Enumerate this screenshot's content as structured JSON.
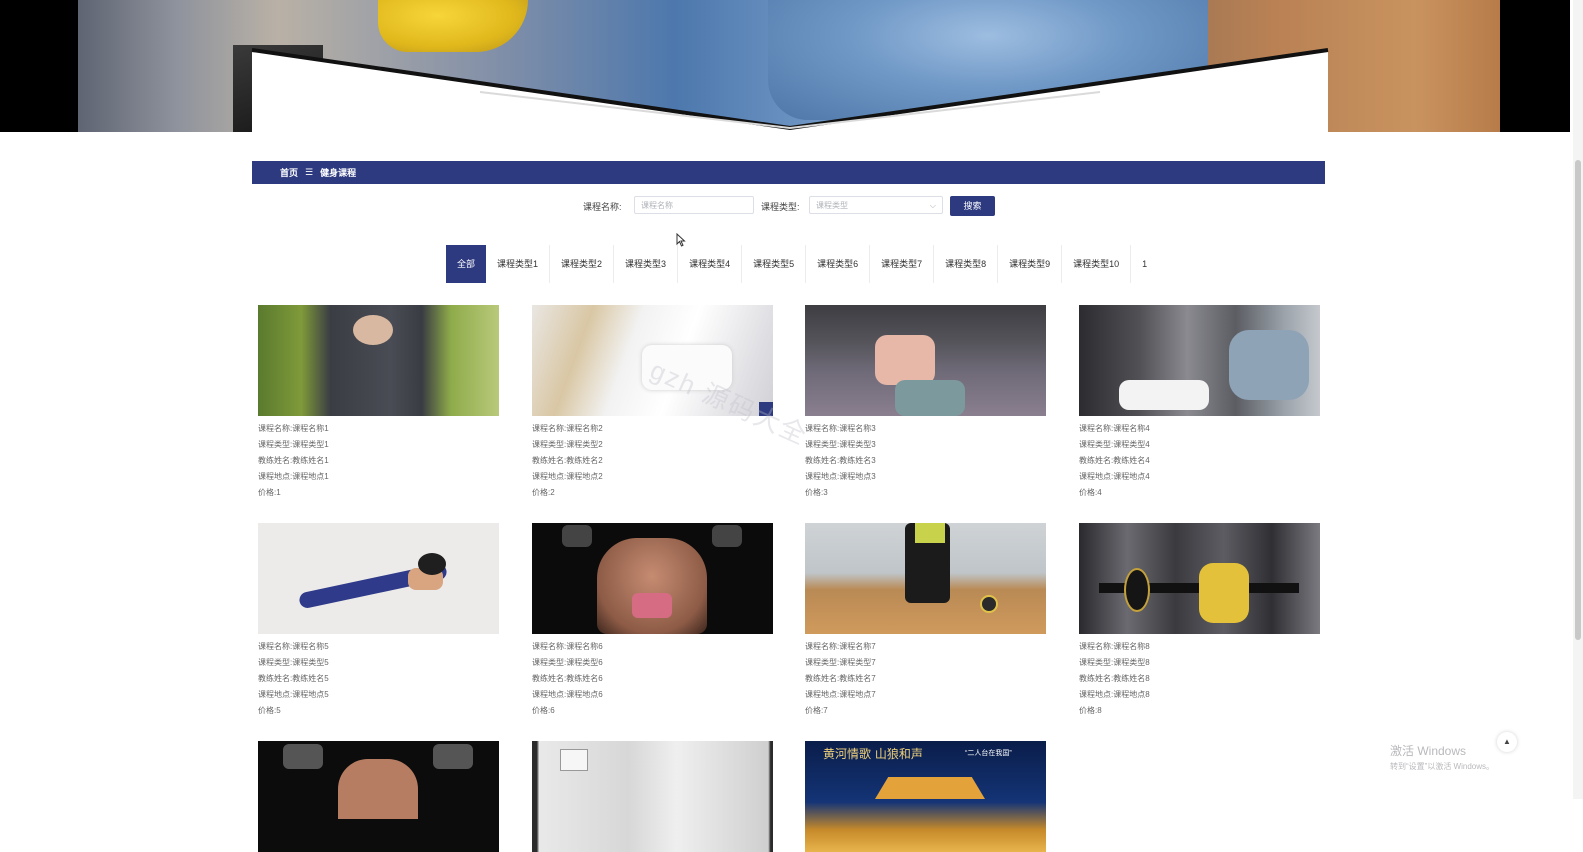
{
  "breadcrumb": {
    "home": "首页",
    "separator": "☰",
    "current": "健身课程"
  },
  "search": {
    "name_label": "课程名称:",
    "name_placeholder": "课程名称",
    "type_label": "课程类型:",
    "type_placeholder": "课程类型",
    "button": "搜索"
  },
  "tabs": [
    "全部",
    "课程类型1",
    "课程类型2",
    "课程类型3",
    "课程类型4",
    "课程类型5",
    "课程类型6",
    "课程类型7",
    "课程类型8",
    "课程类型9",
    "课程类型10",
    "1"
  ],
  "active_tab": "全部",
  "courses": [
    {
      "name_label": "课程名称:",
      "name": "课程名称1",
      "type_label": "课程类型:",
      "type": "课程类型1",
      "coach_label": "教练姓名:",
      "coach": "教练姓名1",
      "place_label": "课程地点:",
      "place": "课程地点1",
      "price_label": "价格:",
      "price": "1",
      "image": "woman-outdoor-workout-photo"
    },
    {
      "name_label": "课程名称:",
      "name": "课程名称2",
      "type_label": "课程类型:",
      "type": "课程类型2",
      "coach_label": "教练姓名:",
      "coach": "教练姓名2",
      "place_label": "课程地点:",
      "place": "课程地点2",
      "price_label": "价格:",
      "price": "2",
      "image": "woman-bench-stretch-photo"
    },
    {
      "name_label": "课程名称:",
      "name": "课程名称3",
      "type_label": "课程类型:",
      "type": "课程类型3",
      "coach_label": "教练姓名:",
      "coach": "教练姓名3",
      "place_label": "课程地点:",
      "place": "课程地点3",
      "price_label": "价格:",
      "price": "3",
      "image": "woman-cable-machine-photo"
    },
    {
      "name_label": "课程名称:",
      "name": "课程名称4",
      "type_label": "课程类型:",
      "type": "课程类型4",
      "coach_label": "教练姓名:",
      "coach": "教练姓名4",
      "place_label": "课程地点:",
      "place": "课程地点4",
      "price_label": "价格:",
      "price": "4",
      "image": "trainer-assisting-woman-photo"
    },
    {
      "name_label": "课程名称:",
      "name": "课程名称5",
      "type_label": "课程类型:",
      "type": "课程类型5",
      "coach_label": "教练姓名:",
      "coach": "教练姓名5",
      "place_label": "课程地点:",
      "place": "课程地点5",
      "price_label": "价格:",
      "price": "5",
      "image": "woman-lunge-photo"
    },
    {
      "name_label": "课程名称:",
      "name": "课程名称6",
      "type_label": "课程类型:",
      "type": "课程类型6",
      "coach_label": "教练姓名:",
      "coach": "教练姓名6",
      "place_label": "课程地点:",
      "place": "课程地点6",
      "price_label": "价格:",
      "price": "6",
      "image": "woman-dumbbell-press-photo"
    },
    {
      "name_label": "课程名称:",
      "name": "课程名称7",
      "type_label": "课程类型:",
      "type": "课程类型7",
      "coach_label": "教练姓名:",
      "coach": "教练姓名7",
      "place_label": "课程地点:",
      "place": "课程地点7",
      "price_label": "价格:",
      "price": "7",
      "image": "gym-floor-ball-photo"
    },
    {
      "name_label": "课程名称:",
      "name": "课程名称8",
      "type_label": "课程类型:",
      "type": "课程类型8",
      "coach_label": "教练姓名:",
      "coach": "教练姓名8",
      "place_label": "课程地点:",
      "place": "课程地点8",
      "price_label": "价格:",
      "price": "8",
      "image": "gym-group-training-photo"
    },
    {
      "image": "dumbbell-back-photo"
    },
    {
      "image": "room-interior-photo"
    },
    {
      "image": "chinese-night-poster",
      "poster_text_left": "黄河情歌 山狼和声",
      "poster_text_right": "“二人台在我国”"
    }
  ],
  "watermark": "gzh 源码大全",
  "windows_activation": {
    "title": "激活 Windows",
    "subtitle": "转到“设置”以激活 Windows。"
  },
  "back_to_top_icon": "caret-up-icon",
  "colors": {
    "primary": "#2d3a80",
    "page_bg": "#ffffff",
    "text": "#666666"
  }
}
